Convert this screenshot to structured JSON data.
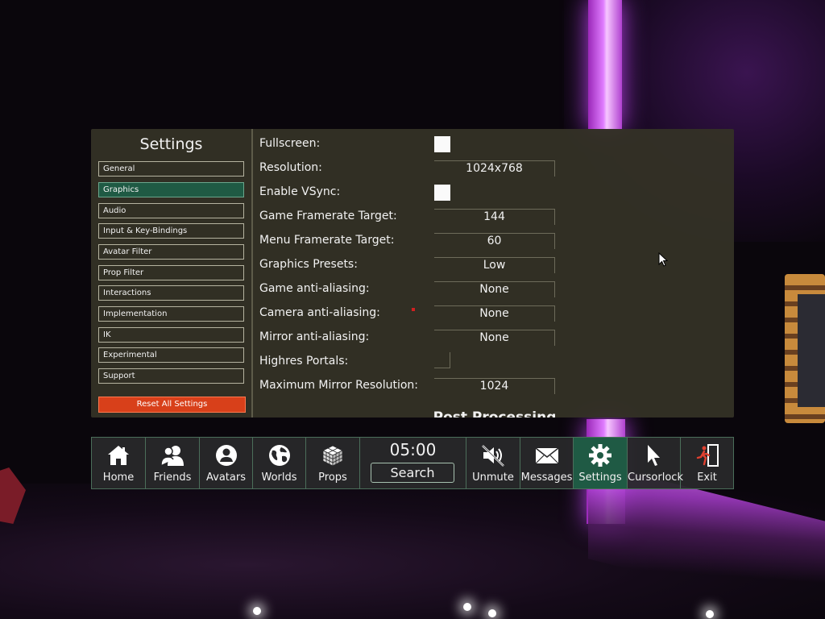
{
  "sidebar": {
    "title": "Settings",
    "items": [
      {
        "label": "General"
      },
      {
        "label": "Graphics"
      },
      {
        "label": "Audio"
      },
      {
        "label": "Input & Key-Bindings"
      },
      {
        "label": "Avatar Filter"
      },
      {
        "label": "Prop Filter"
      },
      {
        "label": "Interactions"
      },
      {
        "label": "Implementation"
      },
      {
        "label": "IK"
      },
      {
        "label": "Experimental"
      },
      {
        "label": "Support"
      }
    ],
    "active_item": "Graphics",
    "reset_label": "Reset All Settings"
  },
  "graphics": {
    "fullscreen": {
      "label": "Fullscreen:",
      "checked": false
    },
    "resolution": {
      "label": "Resolution:",
      "value": "1024x768"
    },
    "vsync": {
      "label": "Enable VSync:",
      "checked": false
    },
    "game_framerate": {
      "label": "Game Framerate Target:",
      "value": "144"
    },
    "menu_framerate": {
      "label": "Menu Framerate Target:",
      "value": "60"
    },
    "presets": {
      "label": "Graphics Presets:",
      "value": "Low"
    },
    "game_aa": {
      "label": "Game anti-aliasing:",
      "value": "None"
    },
    "camera_aa": {
      "label": "Camera anti-aliasing:",
      "value": "None"
    },
    "mirror_aa": {
      "label": "Mirror anti-aliasing:",
      "value": "None"
    },
    "highres_portals": {
      "label": "Highres Portals:",
      "checked": false
    },
    "mirror_resolution": {
      "label": "Maximum Mirror Resolution:",
      "value": "1024"
    },
    "section_next": "Post Processing"
  },
  "dock": {
    "home": "Home",
    "friends": "Friends",
    "avatars": "Avatars",
    "worlds": "Worlds",
    "props": "Props",
    "clock": "05:00",
    "search": "Search",
    "unmute": "Unmute",
    "messages": "Messages",
    "settings": "Settings",
    "cursorlock": "Cursorlock",
    "exit": "Exit"
  },
  "colors": {
    "panel_bg": "#343226",
    "active_green": "#1f5a44",
    "reset_red": "#d8401a",
    "dock_bg": "#28282a"
  }
}
